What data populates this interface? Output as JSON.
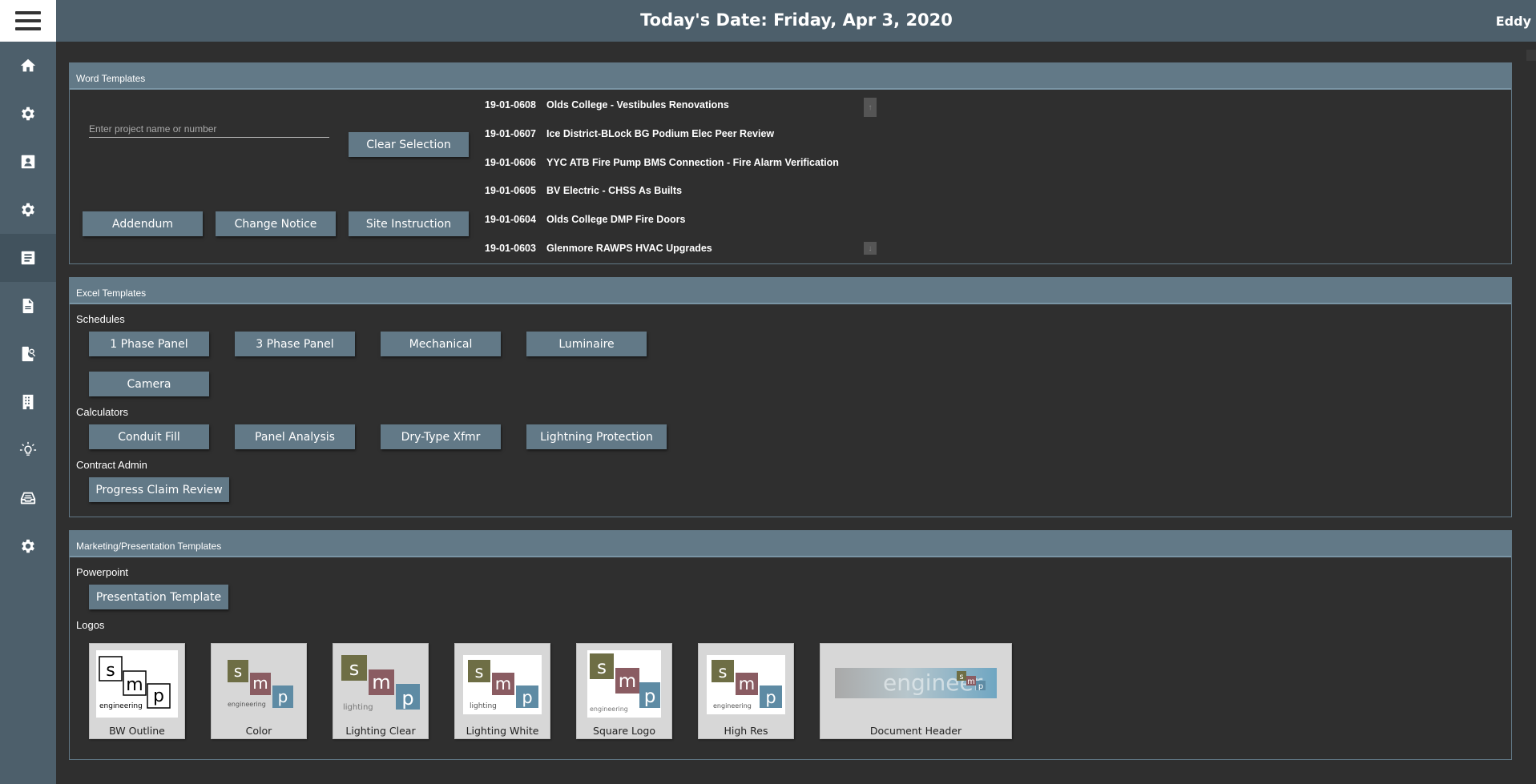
{
  "header": {
    "title": "Today's Date: Friday, Apr 3, 2020",
    "user": "Eddy"
  },
  "sidebar": {
    "items": [
      {
        "icon": "home-icon"
      },
      {
        "icon": "gear-icon"
      },
      {
        "icon": "contact-card-icon"
      },
      {
        "icon": "gear-icon"
      },
      {
        "icon": "document-text-icon"
      },
      {
        "icon": "file-icon"
      },
      {
        "icon": "file-search-icon"
      },
      {
        "icon": "building-icon"
      },
      {
        "icon": "lightbulb-icon"
      },
      {
        "icon": "inbox-tray-icon"
      },
      {
        "icon": "gear-icon"
      }
    ]
  },
  "word": {
    "title": "Word Templates",
    "search_placeholder": "Enter project name or number",
    "clear_label": "Clear Selection",
    "buttons": [
      "Addendum",
      "Change Notice",
      "Site Instruction"
    ],
    "projects": [
      {
        "num": "19-01-0608",
        "name": "Olds College - Vestibules Renovations"
      },
      {
        "num": "19-01-0607",
        "name": "Ice District-BLock BG Podium Elec Peer Review"
      },
      {
        "num": "19-01-0606",
        "name": "YYC ATB Fire Pump BMS Connection - Fire Alarm Verification"
      },
      {
        "num": "19-01-0605",
        "name": "BV Electric - CHSS As Builts"
      },
      {
        "num": "19-01-0604",
        "name": "Olds College DMP Fire Doors"
      },
      {
        "num": "19-01-0603",
        "name": "Glenmore RAWPS HVAC Upgrades"
      }
    ]
  },
  "excel": {
    "title": "Excel Templates",
    "schedules_label": "Schedules",
    "schedules": [
      "1 Phase Panel",
      "3 Phase Panel",
      "Mechanical",
      "Luminaire",
      "Camera"
    ],
    "calculators_label": "Calculators",
    "calculators": [
      "Conduit Fill",
      "Panel Analysis",
      "Dry-Type Xfmr",
      "Lightning Protection"
    ],
    "contract_label": "Contract Admin",
    "contract": [
      "Progress Claim Review"
    ]
  },
  "marketing": {
    "title": "Marketing/Presentation Templates",
    "powerpoint_label": "Powerpoint",
    "powerpoint": [
      "Presentation Template"
    ],
    "logos_label": "Logos",
    "logos": [
      "BW Outline",
      "Color",
      "Lighting Clear",
      "Lighting White",
      "Square Logo",
      "High Res",
      "Document Header"
    ],
    "logo_letters": [
      "s",
      "m",
      "p"
    ],
    "logo_words": [
      "engineering",
      "lighting",
      "engineer"
    ]
  },
  "colors": {
    "panel": "#627987",
    "sidebar": "#4d5f6b",
    "bg": "#2f2f2f",
    "logo_s": "#6e6e45",
    "logo_m": "#8a5c62",
    "logo_p": "#5e8ba4"
  }
}
